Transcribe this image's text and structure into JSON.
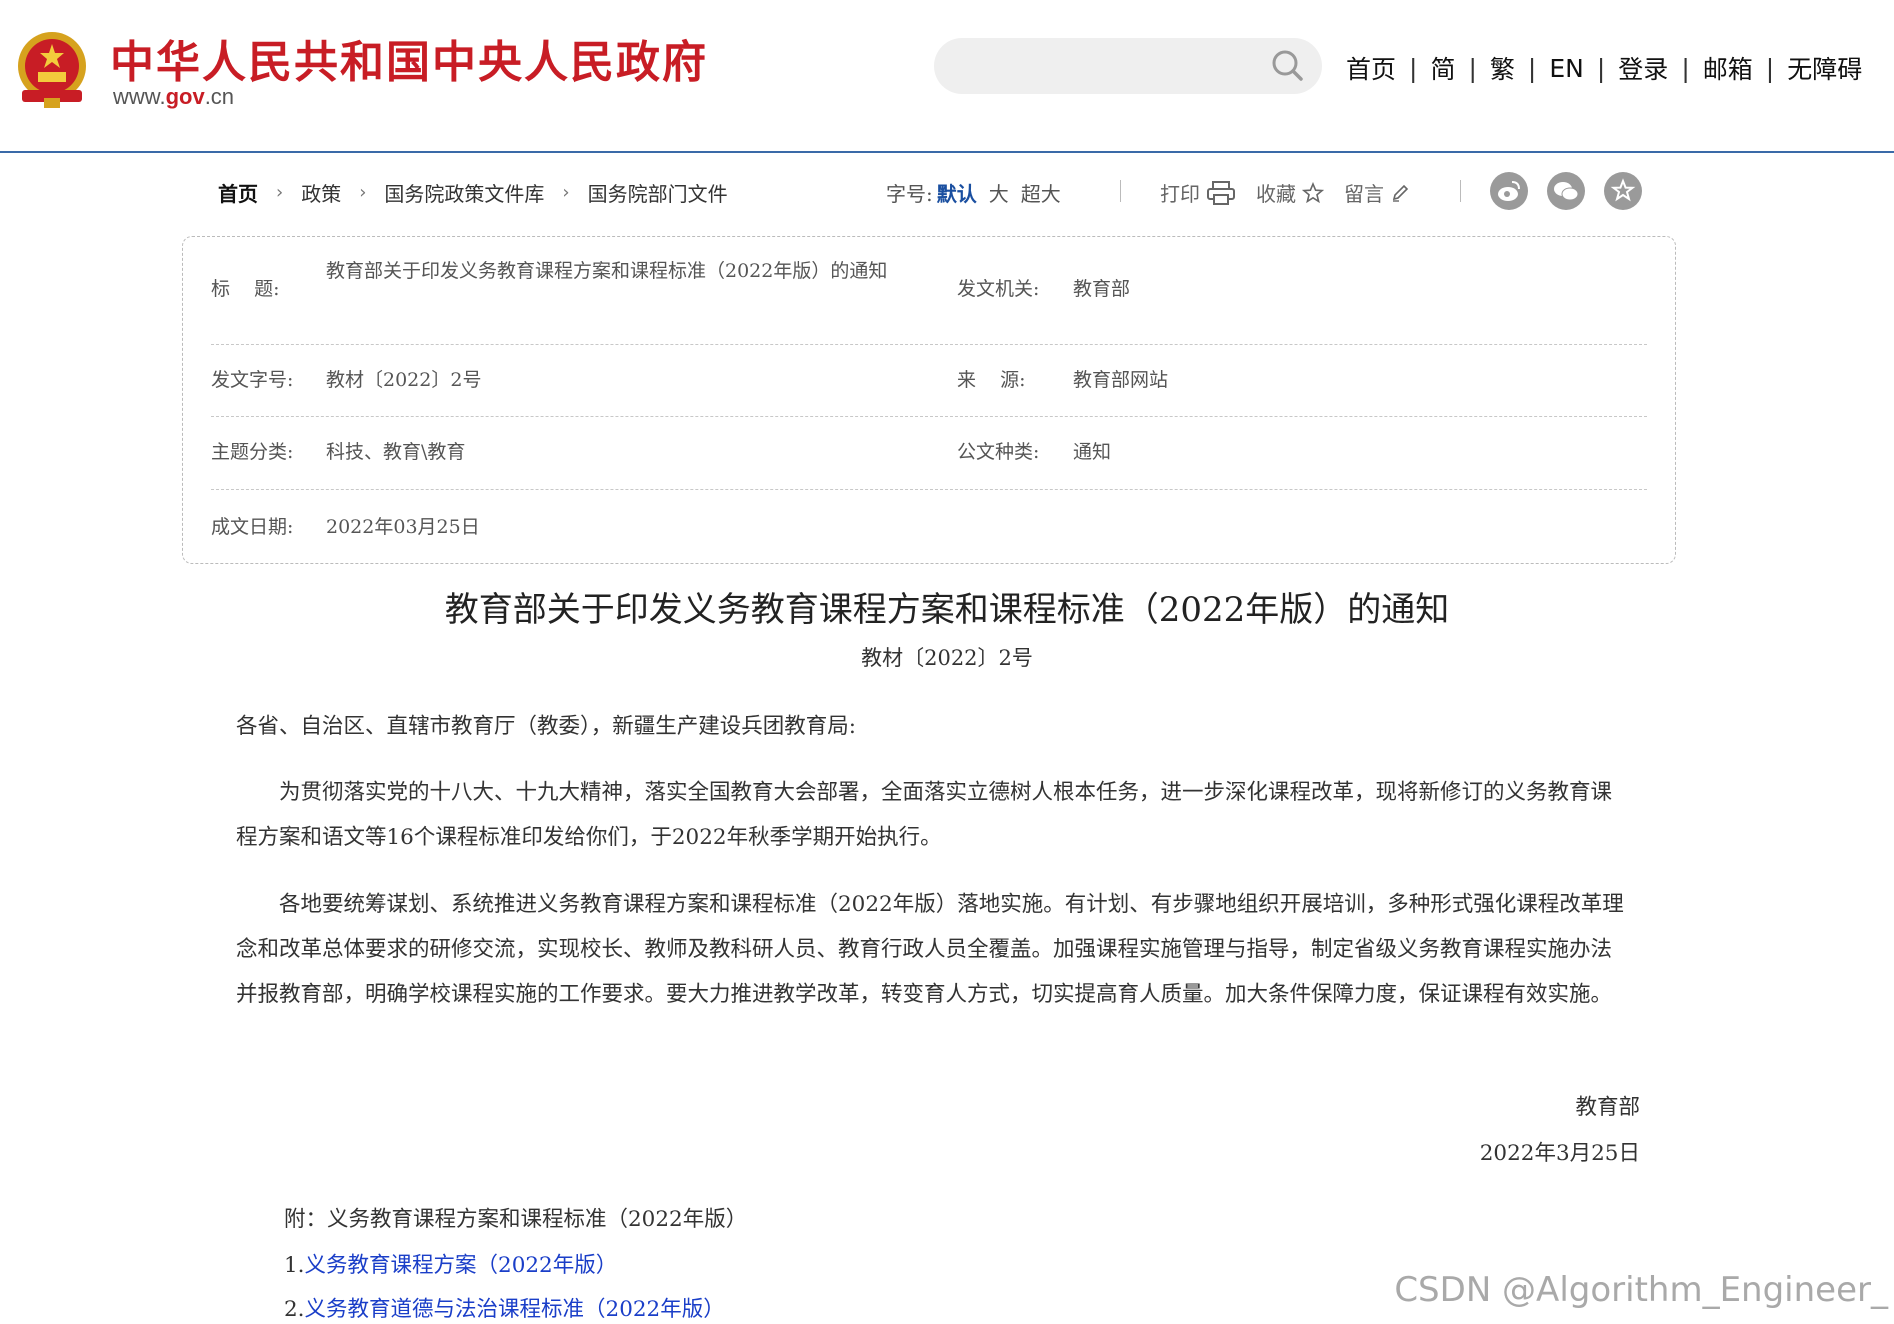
{
  "header": {
    "site_title": "中华人民共和国中央人民政府",
    "site_url_prefix": "www.",
    "site_url_domain": "gov",
    "site_url_suffix": ".cn",
    "search_placeholder": "",
    "nav": [
      "首页",
      "简",
      "繁",
      "EN",
      "登录",
      "邮箱",
      "无障碍"
    ]
  },
  "breadcrumb": [
    "首页",
    "政策",
    "国务院政策文件库",
    "国务院部门文件"
  ],
  "font_size": {
    "label": "字号:",
    "options": [
      "默认",
      "大",
      "超大"
    ]
  },
  "tools": {
    "print": "打印",
    "favorite": "收藏",
    "comment": "留言"
  },
  "share_icons": [
    "weibo-icon",
    "wechat-icon",
    "bookmark-star-icon"
  ],
  "info": {
    "title_label": "标    题:",
    "title_value": "教育部关于印发义务教育课程方案和课程标准（2022年版）的通知",
    "issuer_label": "发文机关:",
    "issuer_value": "教育部",
    "doc_no_label": "发文字号:",
    "doc_no_value": "教材〔2022〕2号",
    "source_label": "来    源:",
    "source_value": "教育部网站",
    "topic_label": "主题分类:",
    "topic_value": "科技、教育\\教育",
    "type_label": "公文种类:",
    "type_value": "通知",
    "date_label": "成文日期:",
    "date_value": "2022年03月25日"
  },
  "document": {
    "title": "教育部关于印发义务教育课程方案和课程标准（2022年版）的通知",
    "doc_no": "教材〔2022〕2号",
    "salutation": "各省、自治区、直辖市教育厅（教委），新疆生产建设兵团教育局:",
    "paragraphs": [
      "为贯彻落实党的十八大、十九大精神，落实全国教育大会部署，全面落实立德树人根本任务，进一步深化课程改革，现将新修订的义务教育课程方案和语文等16个课程标准印发给你们，于2022年秋季学期开始执行。",
      "各地要统筹谋划、系统推进义务教育课程方案和课程标准（2022年版）落地实施。有计划、有步骤地组织开展培训，多种形式强化课程改革理念和改革总体要求的研修交流，实现校长、教师及教科研人员、教育行政人员全覆盖。加强课程实施管理与指导，制定省级义务教育课程实施办法并报教育部，明确学校课程实施的工作要求。要大力推进教学改革，转变育人方式，切实提高育人质量。加大条件保障力度，保证课程有效实施。"
    ],
    "signer": "教育部",
    "sign_date": "2022年3月25日",
    "attachment_head": "附：义务教育课程方案和课程标准（2022年版）",
    "attachments": [
      {
        "num": "1.",
        "text": "义务教育课程方案（2022年版）"
      },
      {
        "num": "2.",
        "text": "义务教育道德与法治课程标准（2022年版）"
      }
    ]
  },
  "watermark": "CSDN @Algorithm_Engineer_",
  "colors": {
    "brand_red": "#c81d25",
    "link_blue": "#1a3ec8",
    "header_rule": "#3a6aa8",
    "active_fontsize": "#1a4fa0"
  }
}
